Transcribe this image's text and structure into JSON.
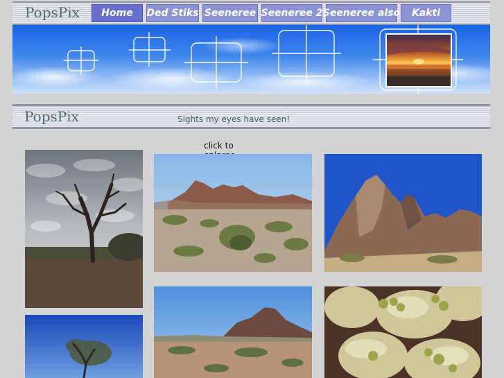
{
  "header": {
    "brand": "PopsPix",
    "nav": [
      {
        "label": "Home",
        "active": true
      },
      {
        "label": "Ded Stiks",
        "active": false
      },
      {
        "label": "Seeneree",
        "active": false
      },
      {
        "label": "Seeneree 2",
        "active": false
      },
      {
        "label": "Seeneree also",
        "active": false
      },
      {
        "label": "Kakti",
        "active": false
      }
    ]
  },
  "subheader": {
    "brand": "PopsPix",
    "tagline": "Sights my eyes have seen!"
  },
  "gallery": {
    "hint": "click to enlarge",
    "photos": [
      {
        "name": "dead-tree-photo"
      },
      {
        "name": "desert-mountains-photo"
      },
      {
        "name": "rock-peak-photo"
      },
      {
        "name": "desert-butte-photo"
      },
      {
        "name": "cholla-cactus-photo"
      },
      {
        "name": "palo-verde-tree-photo"
      }
    ]
  },
  "colors": {
    "nav_button": "#8d94d6",
    "nav_button_active": "#6a6fcf",
    "page_background": "#d3d3d3",
    "bar_border": "#8b96a3"
  }
}
